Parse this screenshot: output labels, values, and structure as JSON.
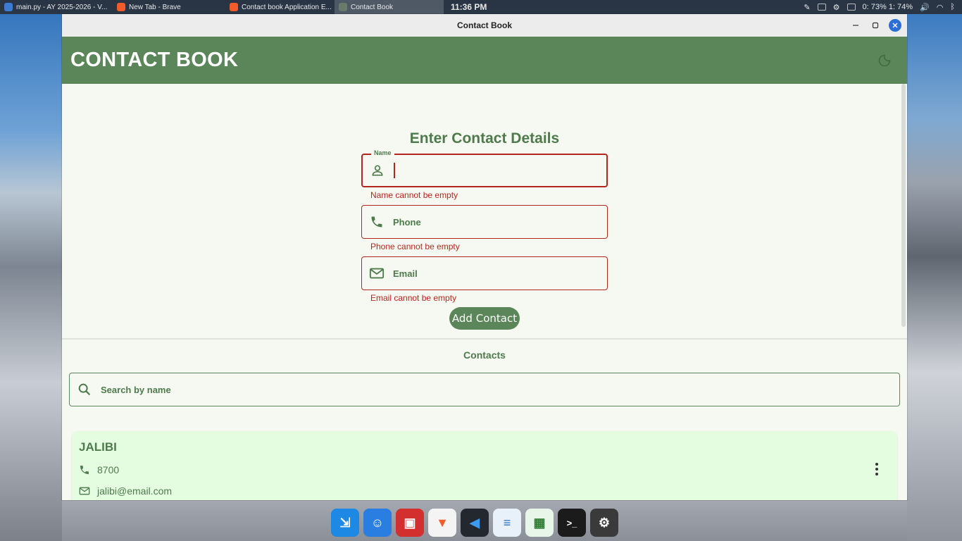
{
  "topbar": {
    "tasks": [
      {
        "label": "main.py - AY 2025-2026 - V...",
        "color": "#3c7bd4"
      },
      {
        "label": "New Tab - Brave",
        "color": "#f25c2a"
      },
      {
        "label": "Contact book Application E...",
        "color": "#f25c2a"
      },
      {
        "label": "Contact Book",
        "color": "#6a7a6a"
      }
    ],
    "clock": "11:36 PM",
    "battery": "0: 73%  1: 74%"
  },
  "window": {
    "title": "Contact Book"
  },
  "appbar": {
    "title": "CONTACT BOOK",
    "theme_icon": "moon-icon"
  },
  "form": {
    "heading": "Enter Contact Details",
    "name": {
      "label": "Name",
      "value": "",
      "error": "Name cannot be empty",
      "icon": "person-icon"
    },
    "phone": {
      "label": "Phone",
      "error": "Phone cannot be empty",
      "icon": "phone-icon"
    },
    "email": {
      "label": "Email",
      "error": "Email cannot be empty",
      "icon": "mail-icon"
    },
    "add_button": "Add Contact"
  },
  "contacts": {
    "heading": "Contacts",
    "search_placeholder": "Search by name",
    "items": [
      {
        "name": "JALIBI",
        "phone": "8700",
        "email": "jalibi@email.com"
      }
    ]
  },
  "dock": [
    {
      "name": "launcher-icon",
      "color": "#1e88e5"
    },
    {
      "name": "finder-icon",
      "color": "#2a7de1"
    },
    {
      "name": "screenshot-icon",
      "color": "#d32f2f"
    },
    {
      "name": "brave-icon",
      "color": "#f4f4f4"
    },
    {
      "name": "vscode-icon",
      "color": "#23272e"
    },
    {
      "name": "writer-icon",
      "color": "#e8f0fa"
    },
    {
      "name": "calc-icon",
      "color": "#e8f5e9"
    },
    {
      "name": "terminal-icon",
      "color": "#1b1b1b"
    },
    {
      "name": "settings-icon",
      "color": "#3a3a3a"
    }
  ],
  "colors": {
    "primary": "#5b8659",
    "error": "#b3261e",
    "background": "#f6f9f1",
    "card": "#e4fde1"
  }
}
